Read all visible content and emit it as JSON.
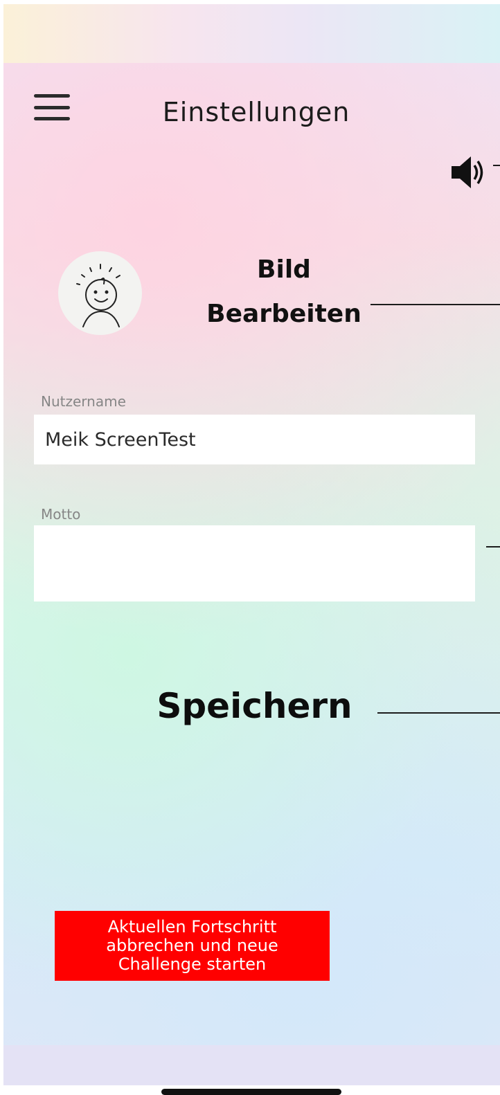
{
  "header": {
    "title": "Einstellungen",
    "menu_icon": "hamburger-menu-icon",
    "sound_icon": "speaker-icon"
  },
  "profile": {
    "avatar_icon": "smiley-face-icon",
    "edit_image_label": "Bild Bearbeiten"
  },
  "form": {
    "username_label": "Nutzername",
    "username_value": "Meik ScreenTest",
    "motto_label": "Motto",
    "motto_value": ""
  },
  "actions": {
    "save_label": "Speichern",
    "reset_label": "Aktuellen Fortschritt abbrechen und neue Challenge starten",
    "reset_color": "#ff0000"
  }
}
